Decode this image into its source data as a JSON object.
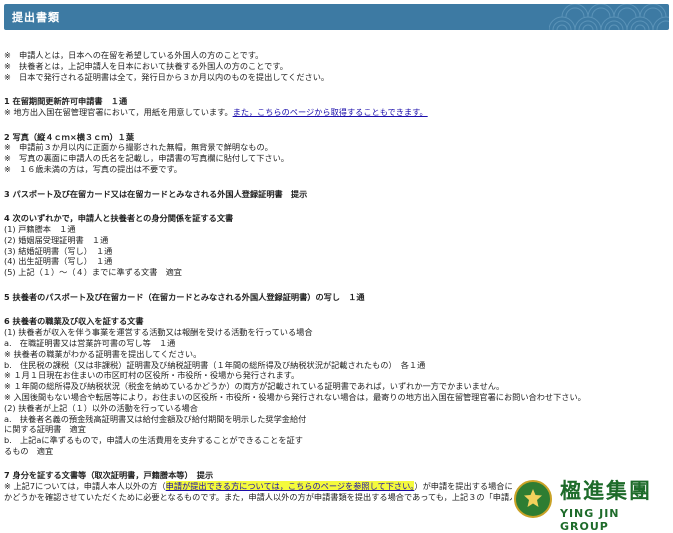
{
  "header": {
    "title": "提出書類"
  },
  "notes": [
    "※　申請人とは，日本への在留を希望している外国人の方のことです。",
    "※　扶養者とは，上記申請人を日本において扶養する外国人の方のことです。",
    "※　日本で発行される証明書は全て，発行日から３か月以内のものを提出してください。"
  ],
  "s1": {
    "title": "1 在留期間更新許可申請書　１通",
    "note": "※ 地方出入国在留管理官署において，用紙を用意しています。",
    "link": "また，こちらのページから取得することもできます。"
  },
  "s2": {
    "title": "2 写真（縦４ｃｍ×横３ｃｍ）１葉",
    "items": [
      "※　申請前３か月以内に正面から撮影された無帽，無背景で鮮明なもの。",
      "※　写真の裏面に申請人の氏名を記載し，申請書の写真欄に貼付して下さい。",
      "※　１６歳未満の方は，写真の提出は不要です。"
    ]
  },
  "s3": {
    "title": "3 パスポート及び在留カード又は在留カードとみなされる外国人登録証明書　提示"
  },
  "s4": {
    "title": "4 次のいずれかで，申請人と扶養者との身分関係を証する文書",
    "items": [
      "(1) 戸籍謄本　１通",
      "(2) 婚姻届受理証明書　１通",
      "(3) 結婚証明書（写し）　１通",
      "(4) 出生証明書（写し）　１通",
      "(5) 上記（１）～（４）までに準ずる文書　適宜"
    ]
  },
  "s5": {
    "title": "5 扶養者のパスポート及び在留カード（在留カードとみなされる外国人登録証明書）の写し　１通"
  },
  "s6": {
    "title": "6 扶養者の職業及び収入を証する文書",
    "items": [
      "(1) 扶養者が収入を伴う事業を運営する活動又は報酬を受ける活動を行っている場合",
      "a.　在職証明書又は営業許可書の写し等　１通",
      "※ 扶養者の職業がわかる証明書を提出してください。",
      "b.　住民税の課税（又は非課税）証明書及び納税証明書（１年間の総所得及び納税状況が記載されたもの）　各１通",
      "※ １月１日現在お住まいの市区町村の区役所・市役所・役場から発行されます。",
      "※ １年間の総所得及び納税状況（税金を納めているかどうか）の両方が記載されている証明書であれば，いずれか一方でかまいません。",
      "※ 入国後間もない場合や転居等により，お住まいの区役所・市役所・役場から発行されない場合は，最寄りの地方出入国在留管理官署にお問い合わせ下さい。",
      "(2) 扶養者が上記（１）以外の活動を行っている場合",
      "a.　扶養者名義の預金残高証明書又は給付金額及び給付期間を明示した奨学金給付",
      "に関する証明書　適宜",
      "b.　上記aに準ずるもので，申請人の生活費用を支弁することができることを証す",
      "るもの　適宜"
    ]
  },
  "s7": {
    "title": "7 身分を証する文書等（取次証明書，戸籍謄本等）　提示",
    "line1_pre": "※ 上記7については，申請人本人以外の方（",
    "line1_link": "申請が提出できる方については，こちらのページを参照して下さい。",
    "line1_post": "）が申請を提出する場合において，申請を提出できる方",
    "line2": "かどうかを確認させていただくために必要となるものです。また，申請人以外の方が申請書類を提出する場合であっても，上記３の「申請人のパスポート及び在留カ"
  },
  "logo": {
    "cn": "楹進集團",
    "en": "YING JIN GROUP"
  },
  "colors": {
    "header": "#3d7aa3",
    "link": "#1a0dab",
    "highlight": "#f4fa3c",
    "logo_green": "#1e6b2a"
  }
}
